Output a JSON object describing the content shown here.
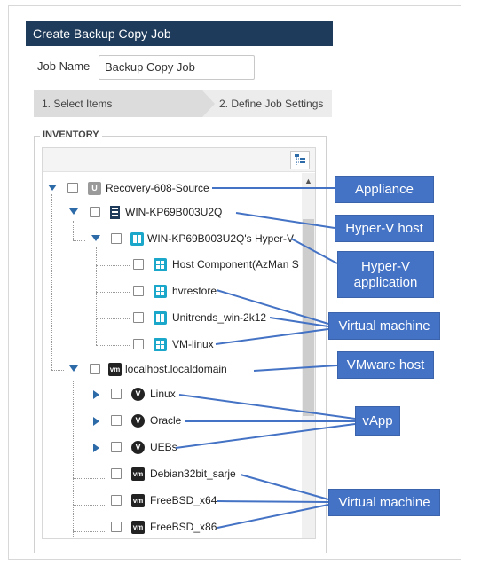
{
  "dialog": {
    "title": "Create Backup Copy Job",
    "job_name_label": "Job Name",
    "job_name_value": "Backup Copy Job"
  },
  "wizard": {
    "steps": [
      {
        "label": "1. Select Items",
        "active": true
      },
      {
        "label": "2. Define Job Settings",
        "active": false
      }
    ]
  },
  "inventory": {
    "legend": "INVENTORY",
    "toolbar_icon": "tree-expand-icon",
    "nodes": [
      {
        "label": "Recovery-608-Source",
        "icon": "appliance-icon",
        "expanded": true
      },
      {
        "label": "WIN-KP69B003U2Q",
        "icon": "hyperv-host-icon",
        "expanded": true
      },
      {
        "label": "WIN-KP69B003U2Q's Hyper-V",
        "icon": "hyperv-application-icon",
        "expanded": true
      },
      {
        "label": "Host Component(AzMan S",
        "icon": "virtual-machine-icon"
      },
      {
        "label": "hvrestore",
        "icon": "virtual-machine-icon"
      },
      {
        "label": "Unitrends_win-2k12",
        "icon": "virtual-machine-icon"
      },
      {
        "label": "VM-linux",
        "icon": "virtual-machine-icon"
      },
      {
        "label": "localhost.localdomain",
        "icon": "vmware-host-icon",
        "expanded": true
      },
      {
        "label": "Linux",
        "icon": "vapp-icon",
        "expanded": false
      },
      {
        "label": "Oracle",
        "icon": "vapp-icon",
        "expanded": false
      },
      {
        "label": "UEBs",
        "icon": "vapp-icon",
        "expanded": false
      },
      {
        "label": "Debian32bit_sarje",
        "icon": "vmware-vm-icon"
      },
      {
        "label": "FreeBSD_x64",
        "icon": "vmware-vm-icon"
      },
      {
        "label": "FreeBSD_x86",
        "icon": "vmware-vm-icon"
      }
    ]
  },
  "callouts": {
    "appliance": "Appliance",
    "hyperv_host": "Hyper-V host",
    "hyperv_app": "Hyper-V application",
    "virtual_machine_1": "Virtual machine",
    "vmware_host": "VMware host",
    "vapp": "vApp",
    "virtual_machine_2": "Virtual machine"
  },
  "colors": {
    "title_bar": "#1f3b5b",
    "callout": "#4472c4",
    "expander": "#2d6aa8"
  }
}
